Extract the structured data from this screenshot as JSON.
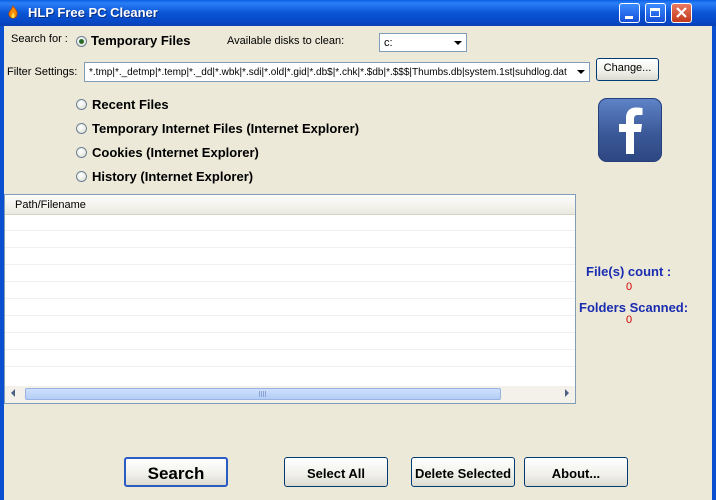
{
  "window": {
    "title": "HLP Free PC Cleaner",
    "controls": [
      "minimize",
      "maximize",
      "close"
    ]
  },
  "search": {
    "label": "Search for :",
    "selected_option": "Temporary Files",
    "disks_label": "Available disks to clean:",
    "disk_value": "c:"
  },
  "filter": {
    "label": "Filter Settings:",
    "value": "*.tmp|*._detmp|*.temp|*._dd|*.wbk|*.sdi|*.old|*.gid|*.db$|*.chk|*.$db|*.$$$|Thumbs.db|system.1st|suhdlog.dat",
    "change_label": "Change..."
  },
  "options": [
    {
      "label": "Recent Files"
    },
    {
      "label": "Temporary Internet Files (Internet Explorer)"
    },
    {
      "label": "Cookies  (Internet Explorer)"
    },
    {
      "label": "History  (Internet Explorer)"
    }
  ],
  "results": {
    "column_header": "Path/Filename"
  },
  "stats": {
    "files_label": "File(s) count :",
    "files_value": "0",
    "folders_label": "Folders Scanned:",
    "folders_value": "0"
  },
  "buttons": {
    "search": "Search",
    "select_all": "Select All",
    "delete_selected": "Delete Selected",
    "about": "About..."
  },
  "colors": {
    "titlebar": "#0a55d6",
    "stat_label": "#1a2cb0",
    "stat_value": "#d00000",
    "facebook": "#3b5998"
  },
  "icons": [
    "app-flame-icon",
    "facebook-icon",
    "scroll-left-icon",
    "scroll-right-icon",
    "dropdown-arrow-icon"
  ]
}
